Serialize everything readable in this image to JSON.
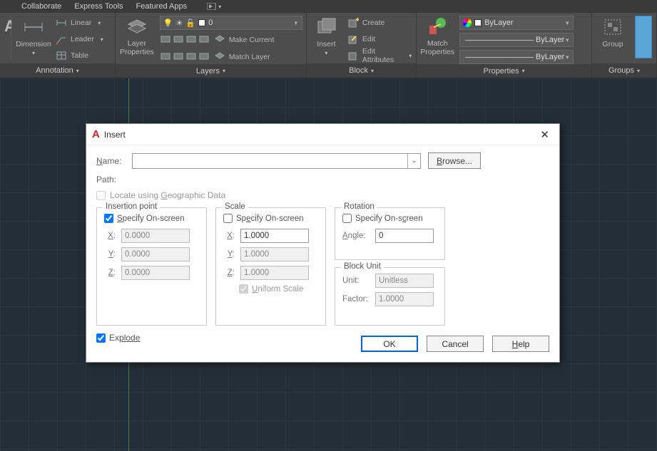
{
  "menubar": {
    "items": [
      "Collaborate",
      "Express Tools",
      "Featured Apps"
    ]
  },
  "ribbon": {
    "annotation": {
      "title": "Annotation",
      "dimension": "Dimension",
      "linear": "Linear",
      "leader": "Leader",
      "table": "Table"
    },
    "layers": {
      "title": "Layers",
      "properties": "Layer\nProperties",
      "current_layer": "0",
      "make_current": "Make Current",
      "match_layer": "Match Layer"
    },
    "block": {
      "title": "Block",
      "insert": "Insert",
      "create": "Create",
      "edit": "Edit",
      "edit_attr": "Edit Attributes"
    },
    "properties": {
      "title": "Properties",
      "match": "Match\nProperties",
      "bylayer": "ByLayer"
    },
    "groups": {
      "title": "Groups",
      "group": "Group"
    }
  },
  "dialog": {
    "title": "Insert",
    "name_label": "Name:",
    "name_value": "",
    "browse_label": "Browse...",
    "path_label": "Path:",
    "locate_label": "Locate using Geographic Data",
    "insertion": {
      "legend": "Insertion point",
      "specify": "Specify On-screen",
      "specify_checked": true,
      "x": "0.0000",
      "y": "0.0000",
      "z": "0.0000"
    },
    "scale": {
      "legend": "Scale",
      "specify": "Specify On-screen",
      "specify_checked": false,
      "x": "1.0000",
      "y": "1.0000",
      "z": "1.0000",
      "uniform": "Uniform Scale",
      "uniform_checked": true
    },
    "rotation": {
      "legend": "Rotation",
      "specify": "Specify On-screen",
      "specify_checked": false,
      "angle_label": "Angle:",
      "angle": "0"
    },
    "blockunit": {
      "legend": "Block Unit",
      "unit_label": "Unit:",
      "unit": "Unitless",
      "factor_label": "Factor:",
      "factor": "1.0000"
    },
    "explode_label": "Explode",
    "explode_checked": true,
    "ok": "OK",
    "cancel": "Cancel",
    "help": "Help"
  }
}
